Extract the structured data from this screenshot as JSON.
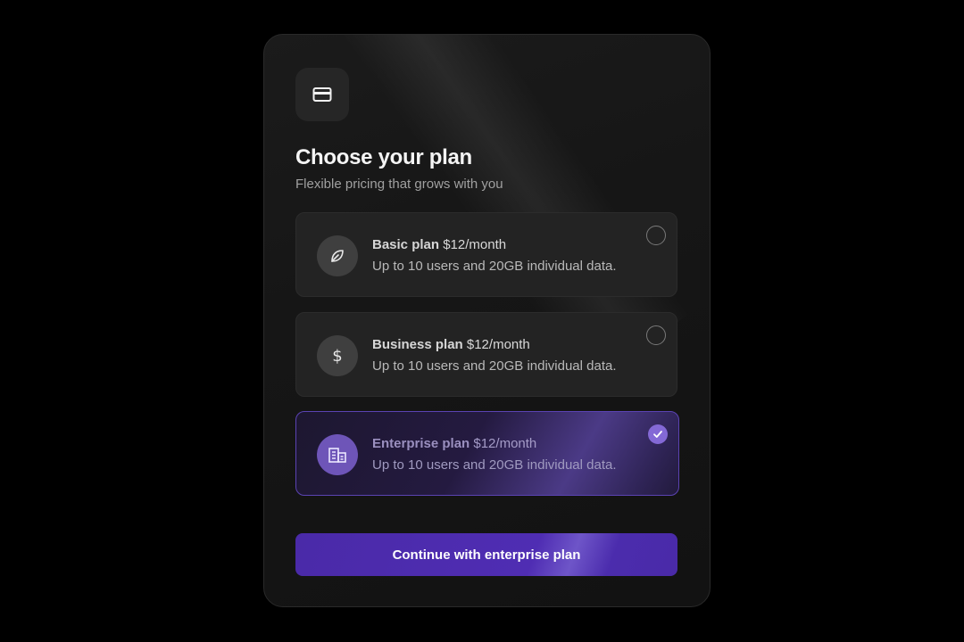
{
  "header": {
    "icon": "credit-card-icon",
    "title": "Choose your plan",
    "subtitle": "Flexible pricing that grows with you"
  },
  "plans": [
    {
      "name": "Basic plan",
      "price": "$12/month",
      "description": "Up to 10 users and 20GB individual data.",
      "icon": "leaf-icon",
      "selected": false
    },
    {
      "name": "Business plan",
      "price": "$12/month",
      "description": "Up to 10 users and 20GB individual data.",
      "icon": "dollar-icon",
      "selected": false
    },
    {
      "name": "Enterprise plan",
      "price": "$12/month",
      "description": "Up to 10 users and 20GB individual data.",
      "icon": "building-icon",
      "selected": true
    }
  ],
  "cta": {
    "label": "Continue with enterprise plan"
  },
  "colors": {
    "accent": "#4f2db3",
    "selected_radio": "#8469d6",
    "background": "#000000",
    "card": "#161616"
  }
}
